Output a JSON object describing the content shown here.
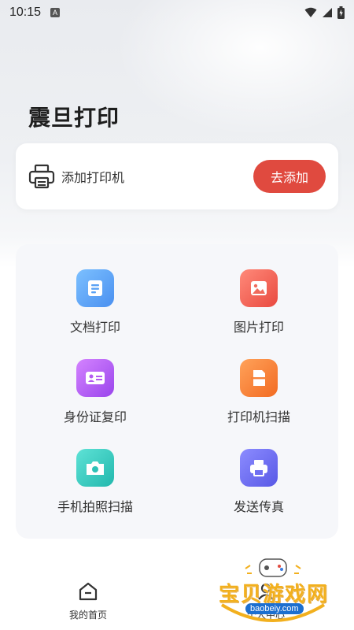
{
  "status_bar": {
    "time": "10:15",
    "notif_letter": "A"
  },
  "app": {
    "title": "震旦打印"
  },
  "printer_card": {
    "label": "添加打印机",
    "button": "去添加"
  },
  "functions": [
    {
      "label": "文档打印",
      "icon": "document-icon",
      "color": "#5aa9f7"
    },
    {
      "label": "图片打印",
      "icon": "image-icon",
      "color": "#f26a5c"
    },
    {
      "label": "身份证复印",
      "icon": "id-card-icon",
      "color": "#b45af2"
    },
    {
      "label": "打印机扫描",
      "icon": "scanner-icon",
      "color": "#f7833a"
    },
    {
      "label": "手机拍照扫描",
      "icon": "camera-icon",
      "color": "#3ecfc4"
    },
    {
      "label": "发送传真",
      "icon": "fax-icon",
      "color": "#6f6ff2"
    }
  ],
  "bottom_nav": {
    "home_label": "我的首页",
    "profile_label": "个人中心"
  },
  "watermark": {
    "title": "宝贝游戏网",
    "url": "baobeiy.com"
  },
  "colors": {
    "accent": "#e04a3f",
    "panel": "#f6f7fa"
  }
}
